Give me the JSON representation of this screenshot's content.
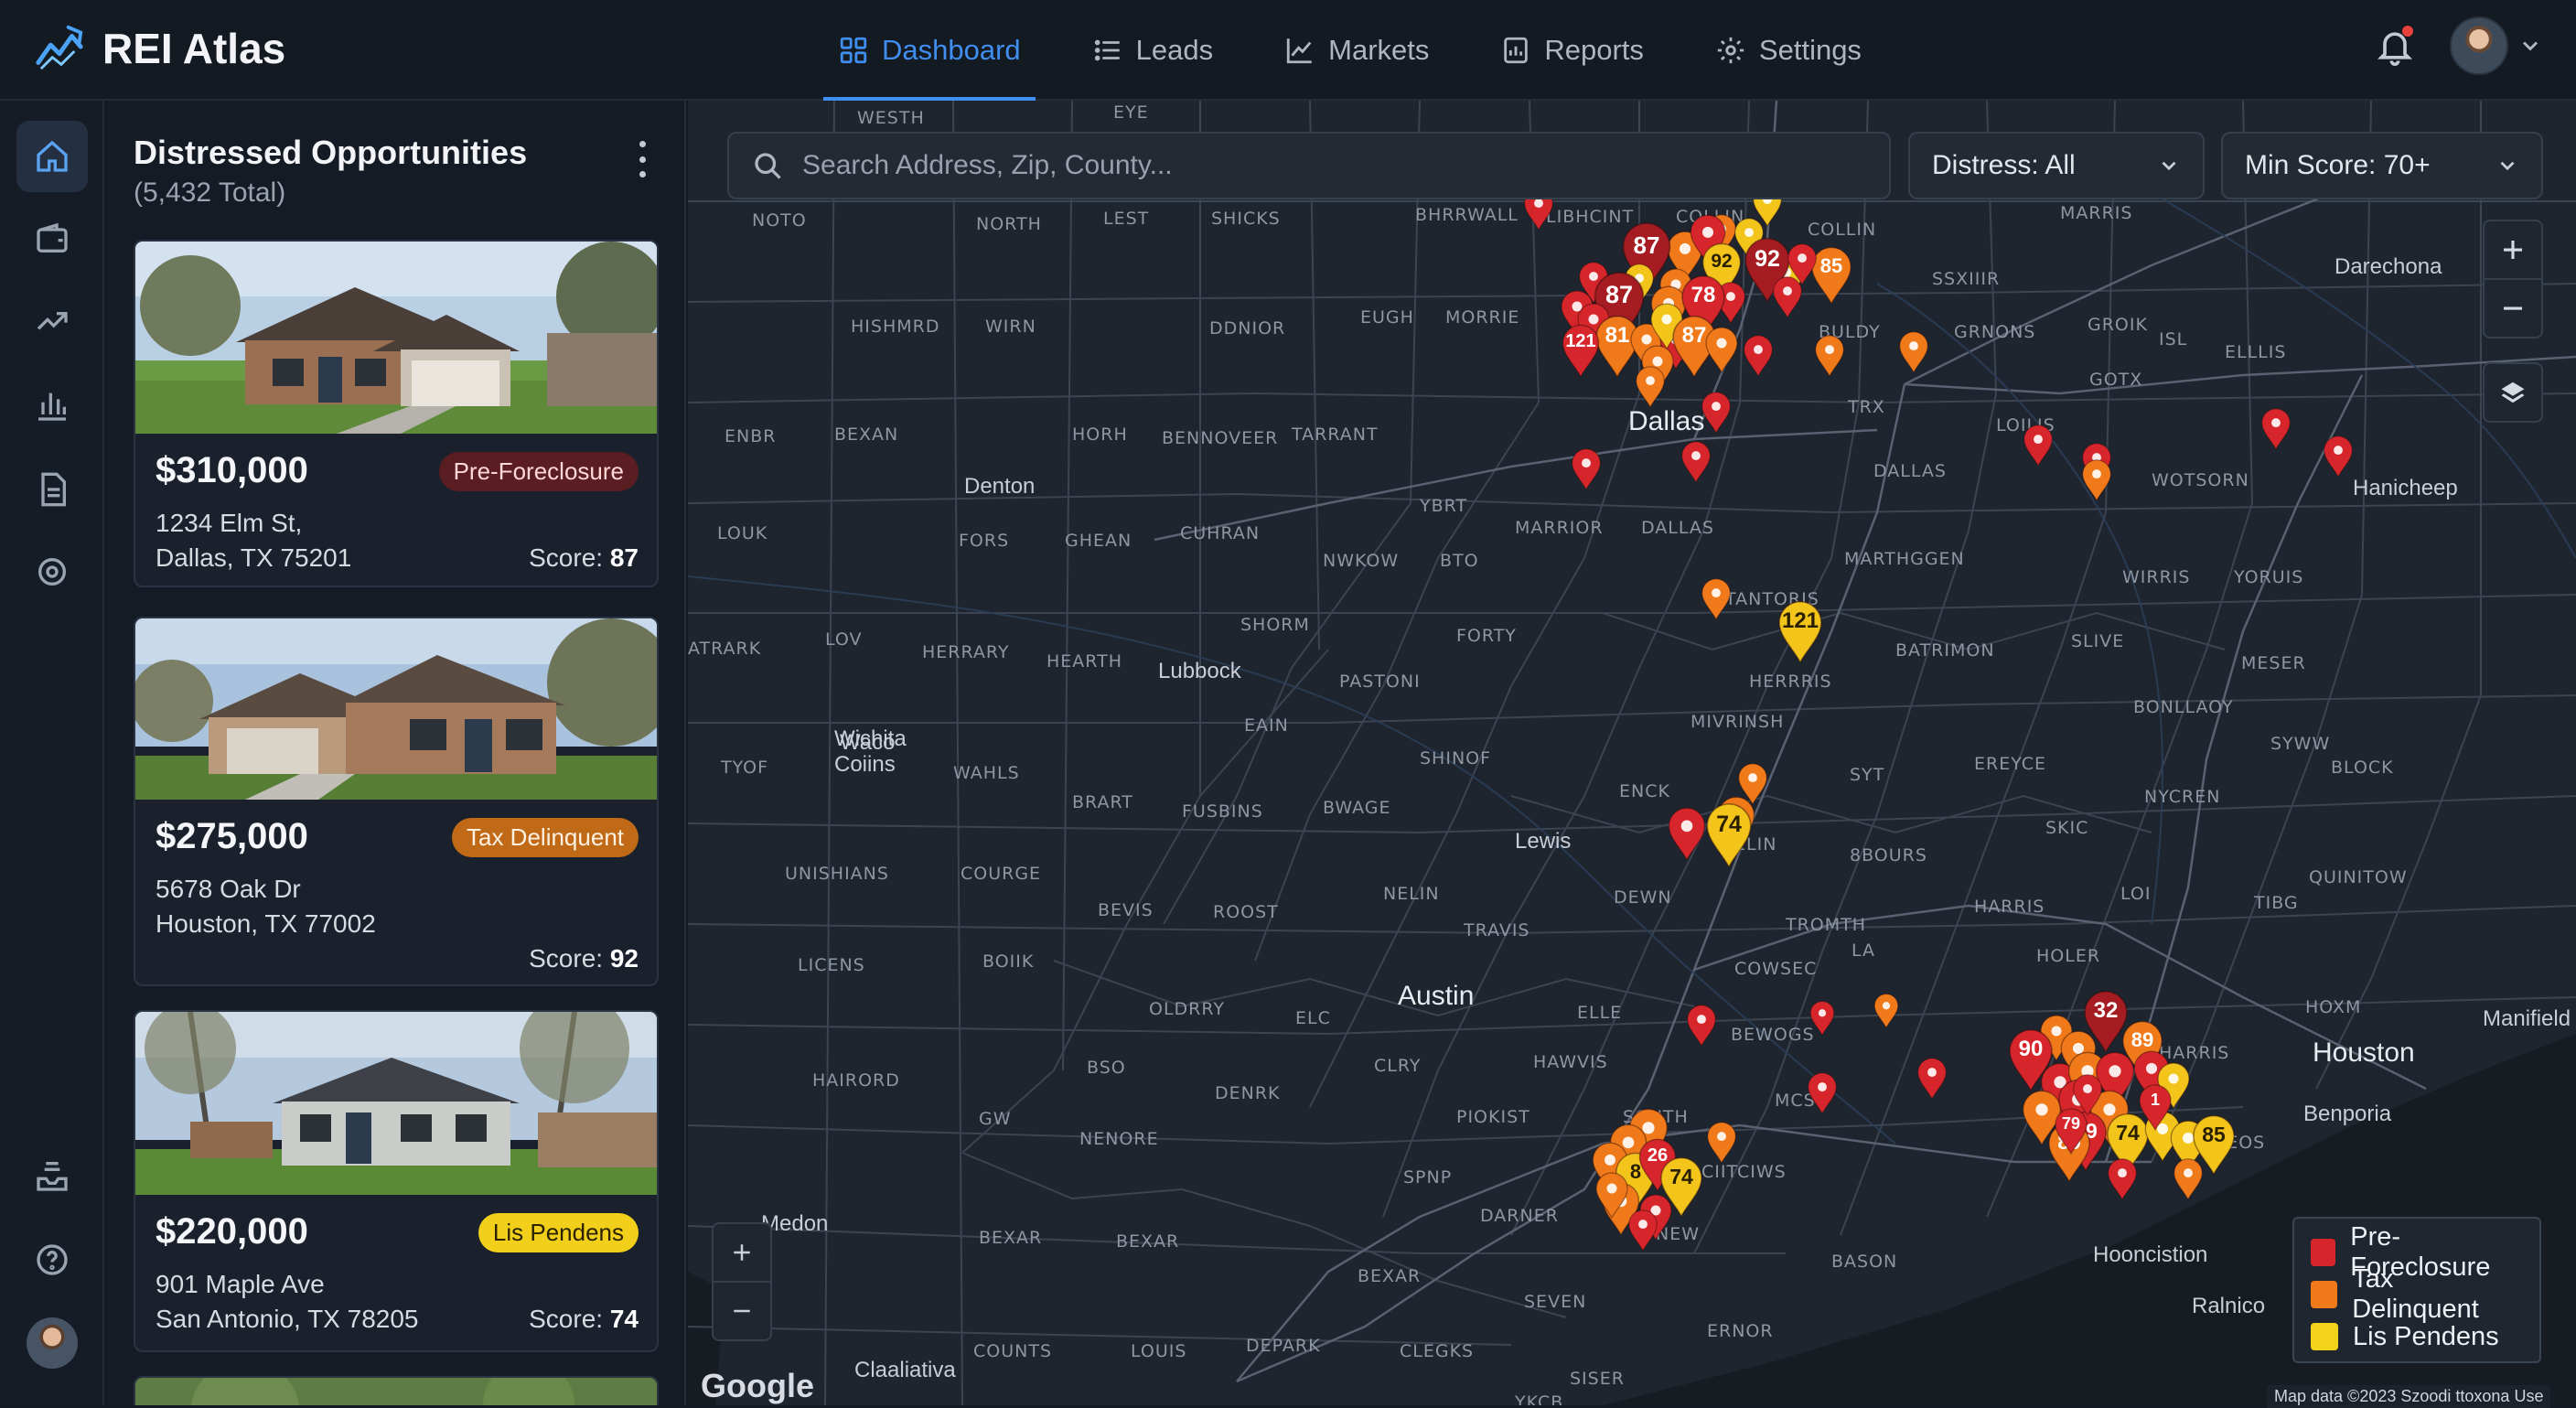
{
  "app": {
    "name": "REI Atlas"
  },
  "nav": {
    "items": [
      {
        "label": "Dashboard",
        "icon": "grid-icon",
        "active": true
      },
      {
        "label": "Leads",
        "icon": "list-icon",
        "active": false
      },
      {
        "label": "Markets",
        "icon": "chart-line-icon",
        "active": false
      },
      {
        "label": "Reports",
        "icon": "report-icon",
        "active": false
      },
      {
        "label": "Settings",
        "icon": "gear-icon",
        "active": false
      }
    ]
  },
  "sidebar": {
    "icons": [
      "home-icon",
      "wallet-icon",
      "trend-icon",
      "bar-chart-icon",
      "document-icon",
      "settings-icon",
      "inbox-icon",
      "help-icon"
    ]
  },
  "panel": {
    "title": "Distressed Opportunities",
    "subtitle": "(5,432 Total)",
    "listings": [
      {
        "price": "$310,000",
        "status": "Pre-Foreclosure",
        "address_line1": "1234 Elm St,",
        "address_line2": "Dallas, TX 75201",
        "score_label": "Score:",
        "score": "87"
      },
      {
        "price": "$275,000",
        "status": "Tax Delinquent",
        "address_line1": "5678 Oak Dr",
        "address_line2": "Houston, TX 77002",
        "score_label": "Score:",
        "score": "92"
      },
      {
        "price": "$220,000",
        "status": "Lis Pendens",
        "address_line1": "901 Maple Ave",
        "address_line2": "San Antonio, TX 78205",
        "score_label": "Score:",
        "score": "74"
      }
    ]
  },
  "search": {
    "placeholder": "Search Address, Zip, County..."
  },
  "filters": {
    "distress": "Distress: All",
    "min_score": "Min Score: 70+"
  },
  "map": {
    "counties": [
      "WESTH",
      "EYE",
      "NOTO",
      "NORTH",
      "LEST",
      "SHICKS",
      "BHRRWALL",
      "LIBHCINT",
      "COLLIN",
      "COLLIN",
      "MARRIS",
      "HISHMRD",
      "WIRN",
      "DDNIOR",
      "EUGH",
      "MORRIE",
      "SSXIIIR",
      "BULDY",
      "GRNONS",
      "GROIK",
      "ISL",
      "ELLLIS",
      "GOTX",
      "ENBR",
      "BEXAN",
      "HORH",
      "BENNOVEER",
      "TARRANT",
      "TRX",
      "LOILIS",
      "DALLAS",
      "WOTSORN",
      "LOUK",
      "FORS",
      "GHEAN",
      "CUHRAN",
      "YBRT",
      "MARRIOR",
      "DALLAS",
      "NWKOW",
      "BTO",
      "MARTHGGEN",
      "WIRRIS",
      "YORUIS",
      "ATRARK",
      "LOV",
      "HERRARY",
      "HEARTH",
      "SHORM",
      "FORTY",
      "TANTORIS",
      "BATRIMON",
      "SLIVE",
      "MESER",
      "PASTONI",
      "HERRRIS",
      "BONLLAOY",
      "EAIN",
      "MIVRINSH",
      "SYWW",
      "BLOCK",
      "TYOF",
      "WAHLS",
      "SHINOF",
      "SYT",
      "EREYCE",
      "NYCREN",
      "BRART",
      "FUSBINS",
      "BWAGE",
      "ENCK",
      "SKIC",
      "QUINITOW",
      "UNISHIANS",
      "COURGE",
      "NELIN",
      "BELIN",
      "8BOURS",
      "BEVIS",
      "ROOST",
      "TRAVIS",
      "DEWN",
      "TROMTH",
      "HARRIS",
      "LOI",
      "TIBG",
      "LICENS",
      "BOIIK",
      "COWSEC",
      "LA",
      "HOLER",
      "OLDRRY",
      "ELC",
      "ELLE",
      "BEWOGS",
      "HOXM",
      "HAIRORD",
      "BSO",
      "CLRY",
      "HAWVIS",
      "HARRIS",
      "GW",
      "DENRK",
      "NENORE",
      "PIOKIST",
      "SOUTH",
      "MCS",
      "REOS",
      "SPNP",
      "CIITCIWS",
      "BEXAR",
      "BEXAR",
      "DARNER",
      "NEW",
      "BASON",
      "BEXAR",
      "SEVEN",
      "ERNOR",
      "COUNTS",
      "LOUIS",
      "DEPARK",
      "CLEGKS",
      "SISER",
      "YKCB"
    ],
    "cities": [
      "Dallas",
      "Houston",
      "Denton",
      "Lubbock",
      "Waco",
      "Austin",
      "Manifield",
      "Benporia",
      "Darechona",
      "Hanicheep",
      "Ralnico",
      "Hooncistion",
      "Claaliativa",
      "Medon",
      "Lewis",
      "Wichita",
      "Coiins"
    ],
    "zoom_in_label": "+",
    "zoom_out_label": "−",
    "pin_labels": [
      "87",
      "92",
      "92",
      "85",
      "87",
      "78",
      "81",
      "87",
      "121",
      "90",
      "74",
      "32",
      "90",
      "90",
      "89",
      "89",
      "74",
      "85",
      "74",
      "1",
      "09",
      "79",
      "26",
      "8"
    ],
    "legend": [
      {
        "label": "Pre-Foreclosure",
        "color": "#d7262b"
      },
      {
        "label": "Tax Delinquent",
        "color": "#f07a1a"
      },
      {
        "label": "Lis Pendens",
        "color": "#f3d21a"
      }
    ],
    "provider": "Google",
    "attribution": "Map data ©2023 Szoodi ttoxona Use"
  },
  "colors": {
    "accent": "#3f8ef0",
    "pre_foreclosure": "#d7262b",
    "tax_delinquent": "#f07a1a",
    "lis_pendens": "#f3d21a"
  }
}
